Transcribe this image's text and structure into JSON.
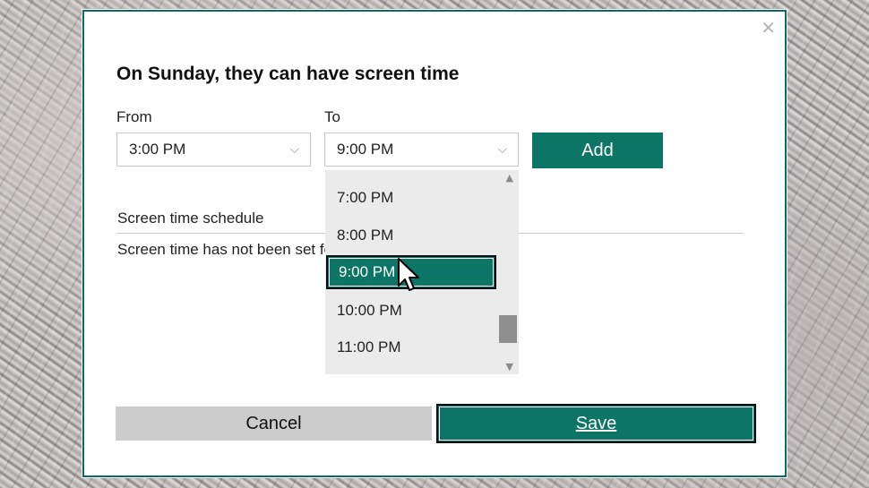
{
  "dialog": {
    "close_glyph": "✕",
    "title": "On Sunday, they can have screen time"
  },
  "from": {
    "label": "From",
    "value": "3:00 PM"
  },
  "to": {
    "label": "To",
    "value": "9:00 PM"
  },
  "add_button": "Add",
  "schedule": {
    "heading": "Screen time schedule",
    "message": "Screen time has not been set fo"
  },
  "to_dropdown": {
    "options": [
      "7:00 PM",
      "8:00 PM",
      "9:00 PM",
      "10:00 PM",
      "11:00 PM"
    ],
    "selected": "9:00 PM"
  },
  "footer": {
    "cancel": "Cancel",
    "save": "Save"
  },
  "colors": {
    "accent": "#0d7566",
    "cancel_bg": "#cccccc",
    "dropdown_bg": "#ebebeb"
  }
}
